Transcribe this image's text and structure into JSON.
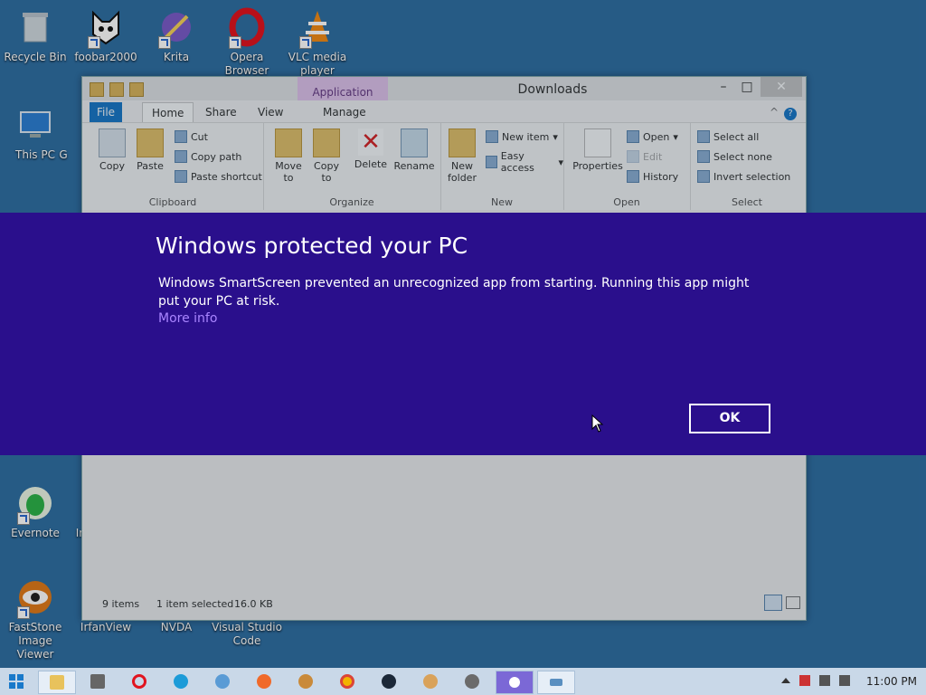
{
  "desktop": {
    "icons": [
      {
        "label": "Recycle Bin"
      },
      {
        "label": "foobar2000"
      },
      {
        "label": "Krita"
      },
      {
        "label": "Opera Browser"
      },
      {
        "label": "VLC media player"
      },
      {
        "label": "This PC"
      },
      {
        "label": "G"
      },
      {
        "label": "Evernote"
      },
      {
        "label": "Ir"
      },
      {
        "label": "FastStone Image Viewer"
      },
      {
        "label": "IrfanView"
      },
      {
        "label": "NVDA"
      },
      {
        "label": "Visual Studio Code"
      }
    ]
  },
  "explorer": {
    "title": "Downloads",
    "context_tab": "Application Tools",
    "tabs": {
      "file": "File",
      "home": "Home",
      "share": "Share",
      "view": "View",
      "manage": "Manage"
    },
    "clipboard": {
      "copy": "Copy",
      "paste": "Paste",
      "cut": "Cut",
      "copy_path": "Copy path",
      "paste_shortcut": "Paste shortcut",
      "group": "Clipboard"
    },
    "organize": {
      "move_to": "Move to",
      "copy_to": "Copy to",
      "delete": "Delete",
      "rename": "Rename",
      "group": "Organize"
    },
    "new": {
      "new_folder": "New folder",
      "new_item": "New item",
      "easy_access": "Easy access",
      "group": "New"
    },
    "open": {
      "properties": "Properties",
      "open": "Open",
      "edit": "Edit",
      "history": "History",
      "group": "Open"
    },
    "select": {
      "select_all": "Select all",
      "select_none": "Select none",
      "invert": "Invert selection",
      "group": "Select"
    },
    "status": {
      "items": "9 items",
      "selected": "1 item selected",
      "size": "16.0 KB"
    }
  },
  "smartscreen": {
    "title": "Windows protected your PC",
    "message": "Windows SmartScreen prevented an unrecognized app from starting. Running this app might put your PC at risk.",
    "more_info": "More info",
    "ok": "OK"
  },
  "taskbar": {
    "clock": "11:00 PM"
  },
  "colors": {
    "banner": "#2a0f8c",
    "link": "#a985ff",
    "desktop": "#2f6fa3"
  }
}
